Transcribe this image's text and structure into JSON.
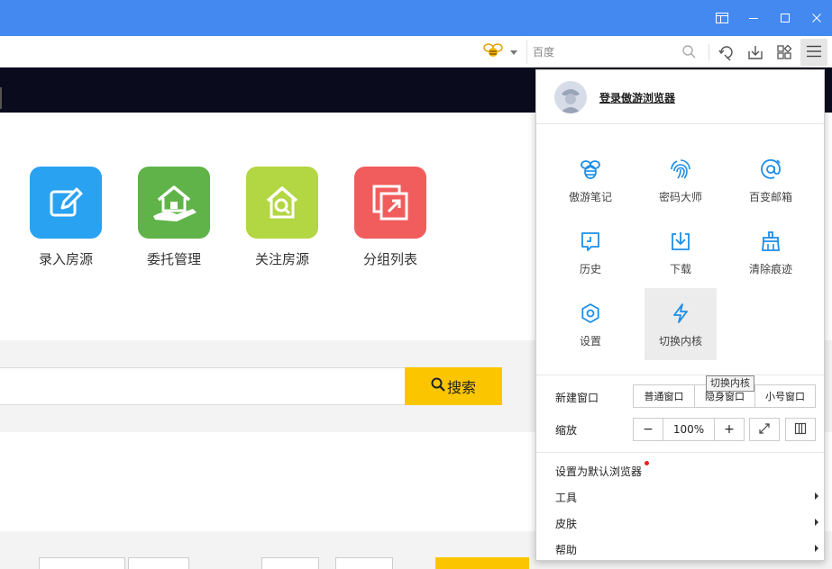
{
  "toolbar": {
    "search_placeholder": "百度",
    "search_engine_icon": "bee-logo-icon"
  },
  "tiles": [
    {
      "label": "录入房源",
      "color": "#2aa2f2",
      "icon": "edit-icon"
    },
    {
      "label": "委托管理",
      "color": "#5fb348",
      "icon": "house-hand-icon"
    },
    {
      "label": "关注房源",
      "color": "#b3d643",
      "icon": "house-search-icon"
    },
    {
      "label": "分组列表",
      "color": "#f15c5c",
      "icon": "group-list-icon"
    }
  ],
  "page_search": {
    "button_label": "搜索"
  },
  "menu": {
    "login_label": "登录傲游浏览器",
    "grid": [
      {
        "label": "傲游笔记",
        "icon": "bee-note-icon"
      },
      {
        "label": "密码大师",
        "icon": "fingerprint-icon"
      },
      {
        "label": "百变邮箱",
        "icon": "email-at-icon"
      },
      {
        "label": "历史",
        "icon": "history-icon"
      },
      {
        "label": "下载",
        "icon": "download-icon"
      },
      {
        "label": "清除痕迹",
        "icon": "broom-icon"
      },
      {
        "label": "设置",
        "icon": "gear-icon"
      },
      {
        "label": "切换内核",
        "icon": "lightning-icon"
      }
    ],
    "tooltip": "切换内核",
    "new_window": {
      "label": "新建窗口",
      "options": [
        "普通窗口",
        "隐身窗口",
        "小号窗口"
      ]
    },
    "zoom": {
      "label": "缩放",
      "minus": "−",
      "value": "100%",
      "plus": "+"
    },
    "items": [
      {
        "label": "设置为默认浏览器",
        "has_submenu": false,
        "dot": true
      },
      {
        "label": "工具",
        "has_submenu": true
      },
      {
        "label": "皮肤",
        "has_submenu": true
      },
      {
        "label": "帮助",
        "has_submenu": true
      }
    ],
    "accent_color": "#1d8ee8"
  }
}
